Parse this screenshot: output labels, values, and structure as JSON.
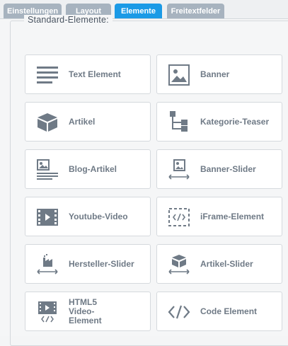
{
  "tabs": [
    {
      "label": "Einstellungen"
    },
    {
      "label": "Layout"
    },
    {
      "label": "Elemente"
    },
    {
      "label": "Freitextfelder"
    }
  ],
  "active_tab": "Elemente",
  "section": {
    "legend": "Standard-Elemente:"
  },
  "elements": [
    {
      "label": "Text Element",
      "icon": "text-lines-icon"
    },
    {
      "label": "Banner",
      "icon": "image-icon"
    },
    {
      "label": "Artikel",
      "icon": "box-icon"
    },
    {
      "label": "Kategorie-Teaser",
      "icon": "category-tree-icon"
    },
    {
      "label": "Blog-Artikel",
      "icon": "blog-article-icon"
    },
    {
      "label": "Banner-Slider",
      "icon": "banner-slider-icon"
    },
    {
      "label": "Youtube-Video",
      "icon": "video-icon"
    },
    {
      "label": "iFrame-Element",
      "icon": "iframe-icon"
    },
    {
      "label": "Hersteller-Slider",
      "icon": "manufacturer-slider-icon"
    },
    {
      "label": "Artikel-Slider",
      "icon": "article-slider-icon"
    },
    {
      "label": "HTML5 Video-Element",
      "icon": "html5-video-icon"
    },
    {
      "label": "Code Element",
      "icon": "code-icon"
    }
  ],
  "colors": {
    "tab_active": "#1b9ae6",
    "tab_inactive": "#a7b3bf",
    "icon": "#6f7a86"
  }
}
